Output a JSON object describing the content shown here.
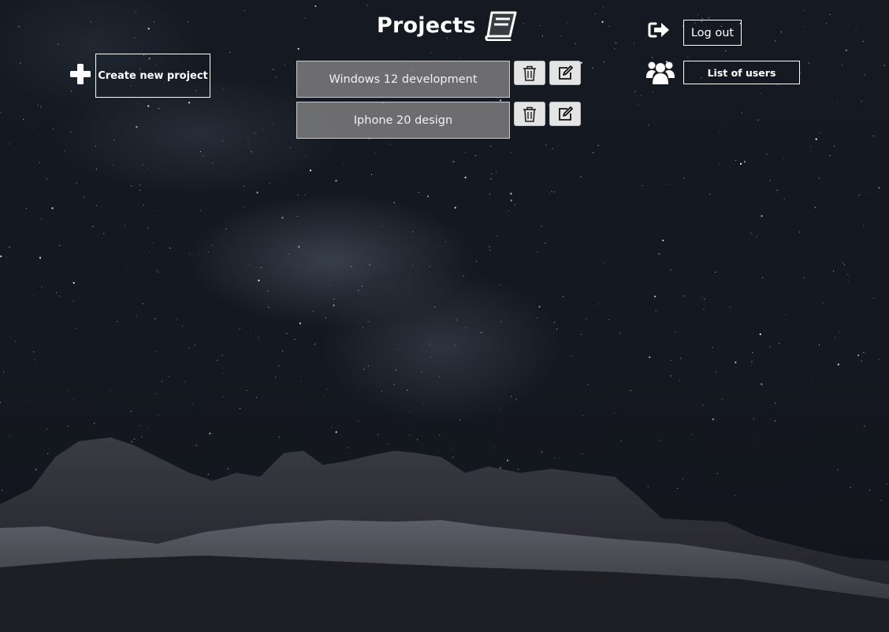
{
  "header": {
    "title": "Projects",
    "title_icon": "book-icon"
  },
  "create": {
    "icon": "plus-icon",
    "label": "Create new project"
  },
  "projects": [
    {
      "name": "Windows 12 development",
      "delete_icon": "trash-icon",
      "edit_icon": "edit-icon"
    },
    {
      "name": "Iphone 20 design",
      "delete_icon": "trash-icon",
      "edit_icon": "edit-icon"
    }
  ],
  "account": {
    "logout_icon": "sign-out-icon",
    "logout_label": "Log out",
    "users_icon": "users-icon",
    "users_label": "List of users"
  },
  "colors": {
    "text": "#ffffff",
    "project_bg": "#7d7d7d",
    "icon_button_bg": "#e4e4e4",
    "background": "#141820"
  }
}
